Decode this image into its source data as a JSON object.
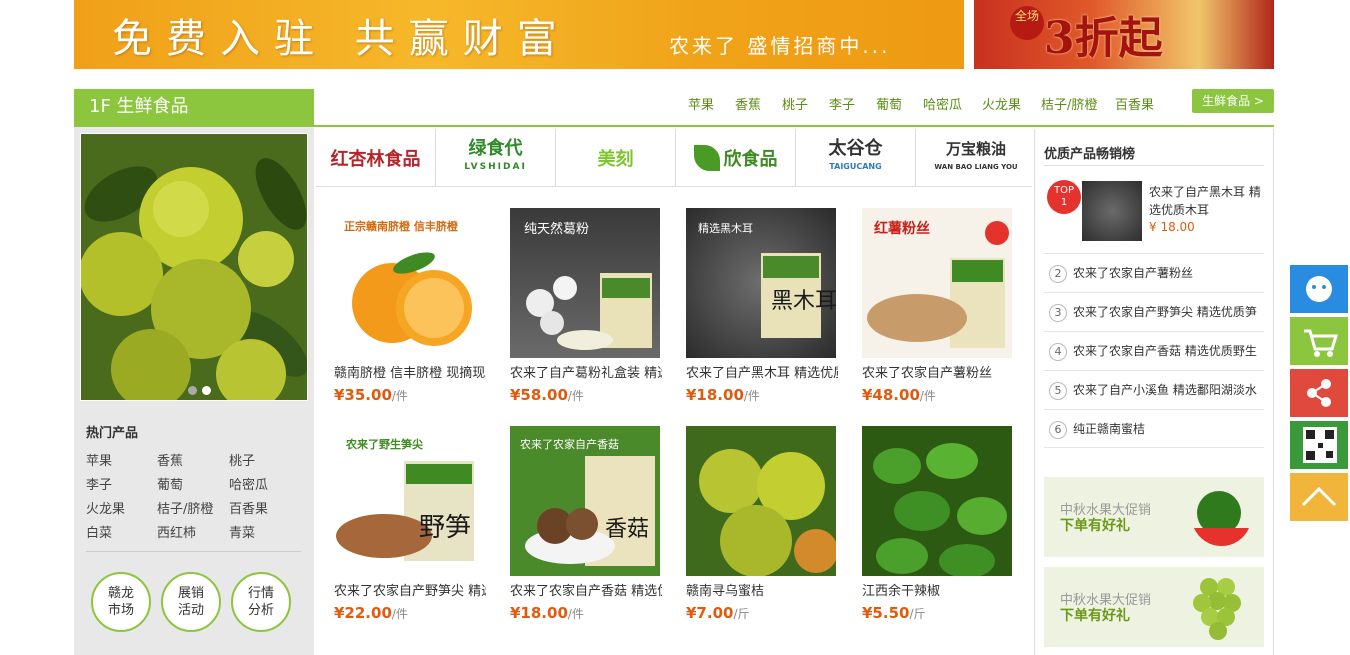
{
  "banner": {
    "main_text": "免费入驻 共赢财富",
    "sub_text": "农来了 盛情招商中...",
    "promo_text": "3折起",
    "promo_badge": "全场"
  },
  "floor": {
    "title": "1F 生鲜食品",
    "links": [
      "苹果",
      "香蕉",
      "桃子",
      "李子",
      "葡萄",
      "哈密瓜",
      "火龙果",
      "桔子/脐橙",
      "百香果"
    ],
    "more_label": "生鲜食品 >"
  },
  "hot": {
    "title": "热门产品",
    "items": [
      "苹果",
      "香蕉",
      "桃子",
      "李子",
      "葡萄",
      "哈密瓜",
      "火龙果",
      "桔子/脐橙",
      "百香果",
      "白菜",
      "西红柿",
      "青菜"
    ]
  },
  "circles": [
    {
      "line1": "赣龙",
      "line2": "市场"
    },
    {
      "line1": "展销",
      "line2": "活动"
    },
    {
      "line1": "行情",
      "line2": "分析"
    }
  ],
  "brands": [
    "红杏林食品",
    "绿食代",
    "美刻",
    "欣食品",
    "太谷仓",
    "万宝粮油"
  ],
  "brand_subs": [
    "",
    "LVSHIDAI",
    "",
    "",
    "TAIGUCANG",
    "WAN BAO LIANG YOU"
  ],
  "products": [
    {
      "name": "赣南脐橙 信丰脐橙 现摘现发",
      "price": "¥35.00",
      "unit": "/件",
      "img_text": "正宗赣南脐橙 信丰脐橙"
    },
    {
      "name": "农来了自产葛粉礼盒装 精选",
      "price": "¥58.00",
      "unit": "/件",
      "img_text": "纯天然葛粉"
    },
    {
      "name": "农来了自产黑木耳 精选优质",
      "price": "¥18.00",
      "unit": "/件",
      "img_text": "精选黑木耳"
    },
    {
      "name": "农来了农家自产薯粉丝",
      "price": "¥48.00",
      "unit": "/件",
      "img_text": "红薯粉丝"
    },
    {
      "name": "农来了农家自产野笋尖 精选",
      "price": "¥22.00",
      "unit": "/件",
      "img_text": "农来了野生笋尖"
    },
    {
      "name": "农来了农家自产香菇 精选优",
      "price": "¥18.00",
      "unit": "/件",
      "img_text": "农来了农家自产香菇"
    },
    {
      "name": "赣南寻乌蜜桔",
      "price": "¥7.00",
      "unit": "/斤",
      "img_text": ""
    },
    {
      "name": "江西余干辣椒",
      "price": "¥5.50",
      "unit": "/斤",
      "img_text": ""
    }
  ],
  "rank": {
    "title": "优质产品畅销榜",
    "top_badge_1": "TOP",
    "top_badge_2": "1",
    "top_name": "农来了自产黑木耳 精选优质木耳",
    "top_price": "¥ 18.00",
    "items": [
      {
        "num": "2",
        "name": "农来了农家自产薯粉丝"
      },
      {
        "num": "3",
        "name": "农来了农家自产野笋尖 精选优质笋"
      },
      {
        "num": "4",
        "name": "农来了农家自产香菇 精选优质野生"
      },
      {
        "num": "5",
        "name": "农来了自产小溪鱼 精选鄱阳湖淡水"
      },
      {
        "num": "6",
        "name": "纯正赣南蜜桔"
      }
    ],
    "promos": [
      {
        "t1": "中秋水果大促销",
        "t2": "下单有好礼"
      },
      {
        "t1": "中秋水果大促销",
        "t2": "下单有好礼"
      }
    ]
  },
  "colors": {
    "green": "#8cc63e",
    "price": "#e15b0f",
    "side_blue": "#2a8ce0",
    "side_green": "#8cc63e",
    "side_red": "#e04a3c",
    "side_qr": "#3a9a3a",
    "side_top": "#f0b53a"
  }
}
